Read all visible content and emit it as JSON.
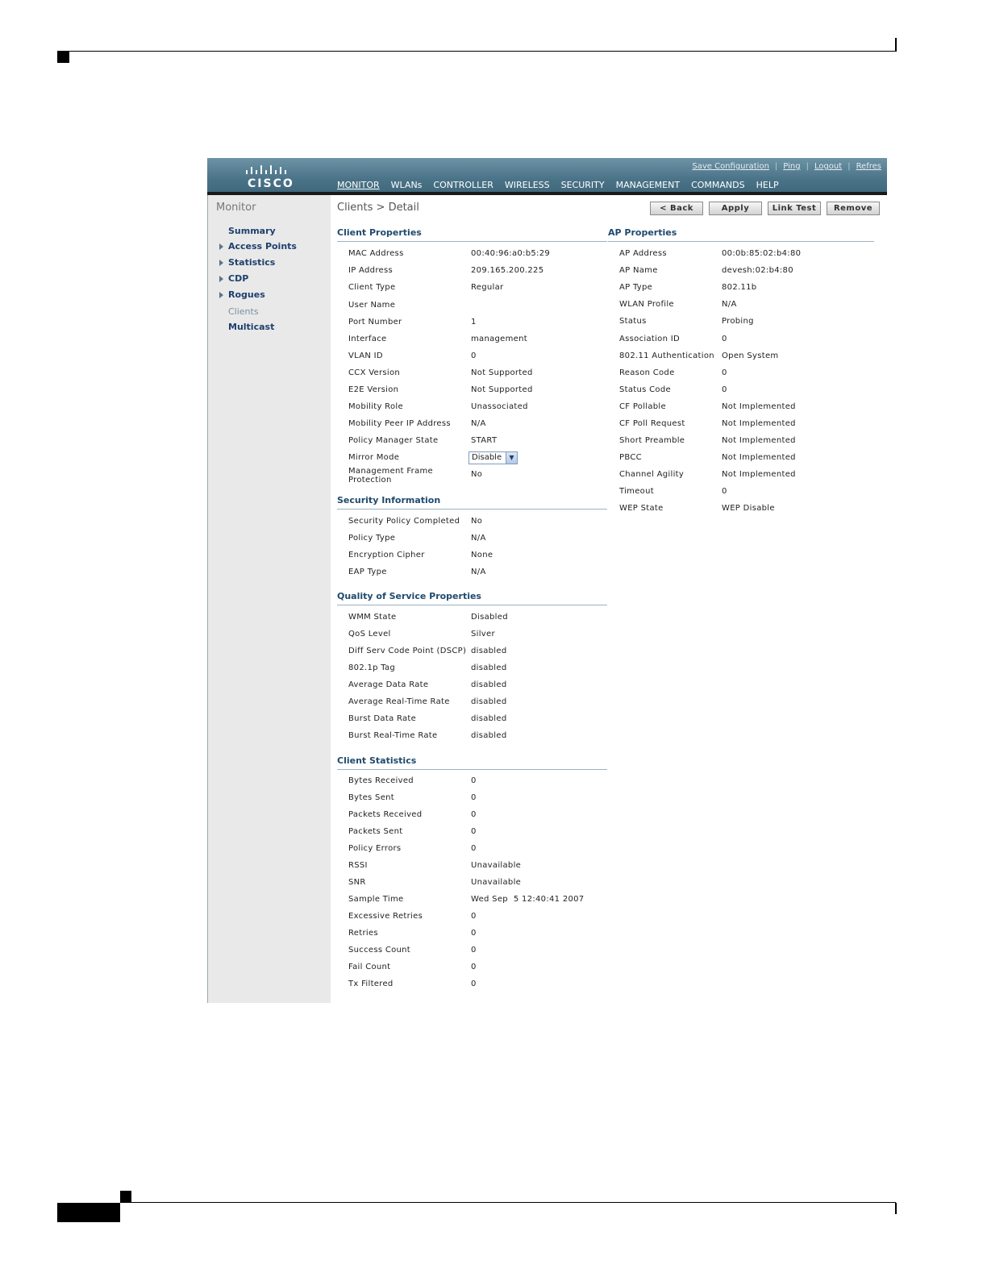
{
  "figure_id": "212215",
  "header": {
    "logo_text": "CISCO",
    "top_links": [
      "Save Configuration",
      "Ping",
      "Logout",
      "Refres"
    ],
    "nav": [
      "MONITOR",
      "WLANs",
      "CONTROLLER",
      "WIRELESS",
      "SECURITY",
      "MANAGEMENT",
      "COMMANDS",
      "HELP"
    ],
    "active_nav": "MONITOR"
  },
  "sidebar": {
    "title": "Monitor",
    "items": [
      {
        "label": "Summary",
        "expandable": false,
        "active": false
      },
      {
        "label": "Access Points",
        "expandable": true,
        "active": false
      },
      {
        "label": "Statistics",
        "expandable": true,
        "active": false
      },
      {
        "label": "CDP",
        "expandable": true,
        "active": false
      },
      {
        "label": "Rogues",
        "expandable": true,
        "active": false
      },
      {
        "label": "Clients",
        "expandable": false,
        "active": true
      },
      {
        "label": "Multicast",
        "expandable": false,
        "active": false
      }
    ]
  },
  "main": {
    "title": "Clients > Detail",
    "buttons": [
      "< Back",
      "Apply",
      "Link Test",
      "Remove"
    ],
    "client_properties": {
      "heading": "Client Properties",
      "rows": [
        {
          "label": "MAC Address",
          "value": "00:40:96:a0:b5:29"
        },
        {
          "label": "IP Address",
          "value": "209.165.200.225"
        },
        {
          "label": "Client Type",
          "value": "Regular"
        },
        {
          "label": "User Name",
          "value": ""
        },
        {
          "label": "Port Number",
          "value": "1"
        },
        {
          "label": "Interface",
          "value": "management"
        },
        {
          "label": "VLAN ID",
          "value": "0"
        },
        {
          "label": "CCX Version",
          "value": "Not Supported"
        },
        {
          "label": "E2E Version",
          "value": "Not Supported"
        },
        {
          "label": "Mobility Role",
          "value": "Unassociated"
        },
        {
          "label": "Mobility Peer IP Address",
          "value": "N/A"
        },
        {
          "label": "Policy Manager State",
          "value": "START"
        },
        {
          "label": "Mirror Mode",
          "value": "Disable"
        },
        {
          "label": "Management Frame Protection",
          "value": "No"
        }
      ]
    },
    "ap_properties": {
      "heading": "AP Properties",
      "rows": [
        {
          "label": "AP Address",
          "value": "00:0b:85:02:b4:80"
        },
        {
          "label": "AP Name",
          "value": "devesh:02:b4:80"
        },
        {
          "label": "AP Type",
          "value": "802.11b"
        },
        {
          "label": "WLAN Profile",
          "value": "N/A"
        },
        {
          "label": "Status",
          "value": "Probing"
        },
        {
          "label": "Association ID",
          "value": "0"
        },
        {
          "label": "802.11 Authentication",
          "value": "Open System"
        },
        {
          "label": "Reason Code",
          "value": "0"
        },
        {
          "label": "Status Code",
          "value": "0"
        },
        {
          "label": "CF Pollable",
          "value": "Not Implemented"
        },
        {
          "label": "CF Poll Request",
          "value": "Not Implemented"
        },
        {
          "label": "Short Preamble",
          "value": "Not Implemented"
        },
        {
          "label": "PBCC",
          "value": "Not Implemented"
        },
        {
          "label": "Channel Agility",
          "value": "Not Implemented"
        },
        {
          "label": "Timeout",
          "value": "0"
        },
        {
          "label": "WEP State",
          "value": "WEP Disable"
        }
      ]
    },
    "security_information": {
      "heading": "Security Information",
      "rows": [
        {
          "label": "Security Policy Completed",
          "value": "No"
        },
        {
          "label": "Policy Type",
          "value": "N/A"
        },
        {
          "label": "Encryption Cipher",
          "value": "None"
        },
        {
          "label": "EAP Type",
          "value": "N/A"
        }
      ]
    },
    "qos_properties": {
      "heading": "Quality of Service Properties",
      "rows": [
        {
          "label": "WMM State",
          "value": "Disabled"
        },
        {
          "label": "QoS Level",
          "value": "Silver"
        },
        {
          "label": "Diff Serv Code Point (DSCP)",
          "value": "disabled"
        },
        {
          "label": "802.1p Tag",
          "value": "disabled"
        },
        {
          "label": "Average Data Rate",
          "value": "disabled"
        },
        {
          "label": "Average Real-Time Rate",
          "value": "disabled"
        },
        {
          "label": "Burst Data Rate",
          "value": "disabled"
        },
        {
          "label": "Burst Real-Time Rate",
          "value": "disabled"
        }
      ]
    },
    "client_statistics": {
      "heading": "Client Statistics",
      "rows": [
        {
          "label": "Bytes Received",
          "value": "0"
        },
        {
          "label": "Bytes Sent",
          "value": "0"
        },
        {
          "label": "Packets Received",
          "value": "0"
        },
        {
          "label": "Packets Sent",
          "value": "0"
        },
        {
          "label": "Policy Errors",
          "value": "0"
        },
        {
          "label": "RSSI",
          "value": "Unavailable"
        },
        {
          "label": "SNR",
          "value": "Unavailable"
        },
        {
          "label": "Sample Time",
          "value": "Wed Sep  5 12:40:41 2007"
        },
        {
          "label": "Excessive Retries",
          "value": "0"
        },
        {
          "label": "Retries",
          "value": "0"
        },
        {
          "label": "Success Count",
          "value": "0"
        },
        {
          "label": "Fail Count",
          "value": "0"
        },
        {
          "label": "Tx Filtered",
          "value": "0"
        }
      ]
    }
  }
}
